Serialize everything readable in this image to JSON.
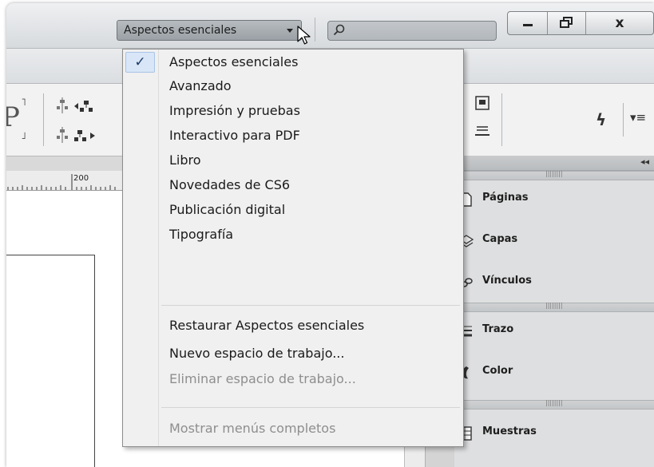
{
  "titlebar": {
    "workspace_label": "Aspectos esenciales",
    "search_placeholder": "",
    "minimize_icon": "minimize-icon",
    "restore_icon": "restore-icon",
    "close_glyph": "x"
  },
  "ruler": {
    "label": "200"
  },
  "panels": {
    "group1": [
      {
        "label": "Páginas",
        "icon": "pages-icon"
      },
      {
        "label": "Capas",
        "icon": "layers-icon"
      },
      {
        "label": "Vínculos",
        "icon": "links-icon"
      }
    ],
    "group2": [
      {
        "label": "Trazo",
        "icon": "stroke-icon"
      },
      {
        "label": "Color",
        "icon": "color-icon"
      }
    ],
    "group3": [
      {
        "label": "Muestras",
        "icon": "swatches-icon"
      }
    ]
  },
  "menu": {
    "items": [
      {
        "label": "Aspectos esenciales",
        "checked": true,
        "enabled": true
      },
      {
        "label": "Avanzado",
        "enabled": true
      },
      {
        "label": "Impresión y pruebas",
        "enabled": true
      },
      {
        "label": "Interactivo para PDF",
        "enabled": true
      },
      {
        "label": "Libro",
        "enabled": true
      },
      {
        "label": "Novedades de CS6",
        "enabled": true
      },
      {
        "label": "Publicación digital",
        "enabled": true
      },
      {
        "label": "Tipografía",
        "enabled": true
      }
    ],
    "actions": [
      {
        "label": "Restaurar Aspectos esenciales",
        "enabled": true
      },
      {
        "label": "Nuevo espacio de trabajo...",
        "enabled": true
      },
      {
        "label": "Eliminar espacio de trabajo...",
        "enabled": false
      }
    ],
    "footer": [
      {
        "label": "Mostrar menús completos",
        "enabled": false
      }
    ],
    "check_glyph": "✓"
  },
  "colors": {
    "menu_bg": "#f0f0f0",
    "check_highlight": "#d8e6f7",
    "disabled_text": "#8e8e8e"
  }
}
